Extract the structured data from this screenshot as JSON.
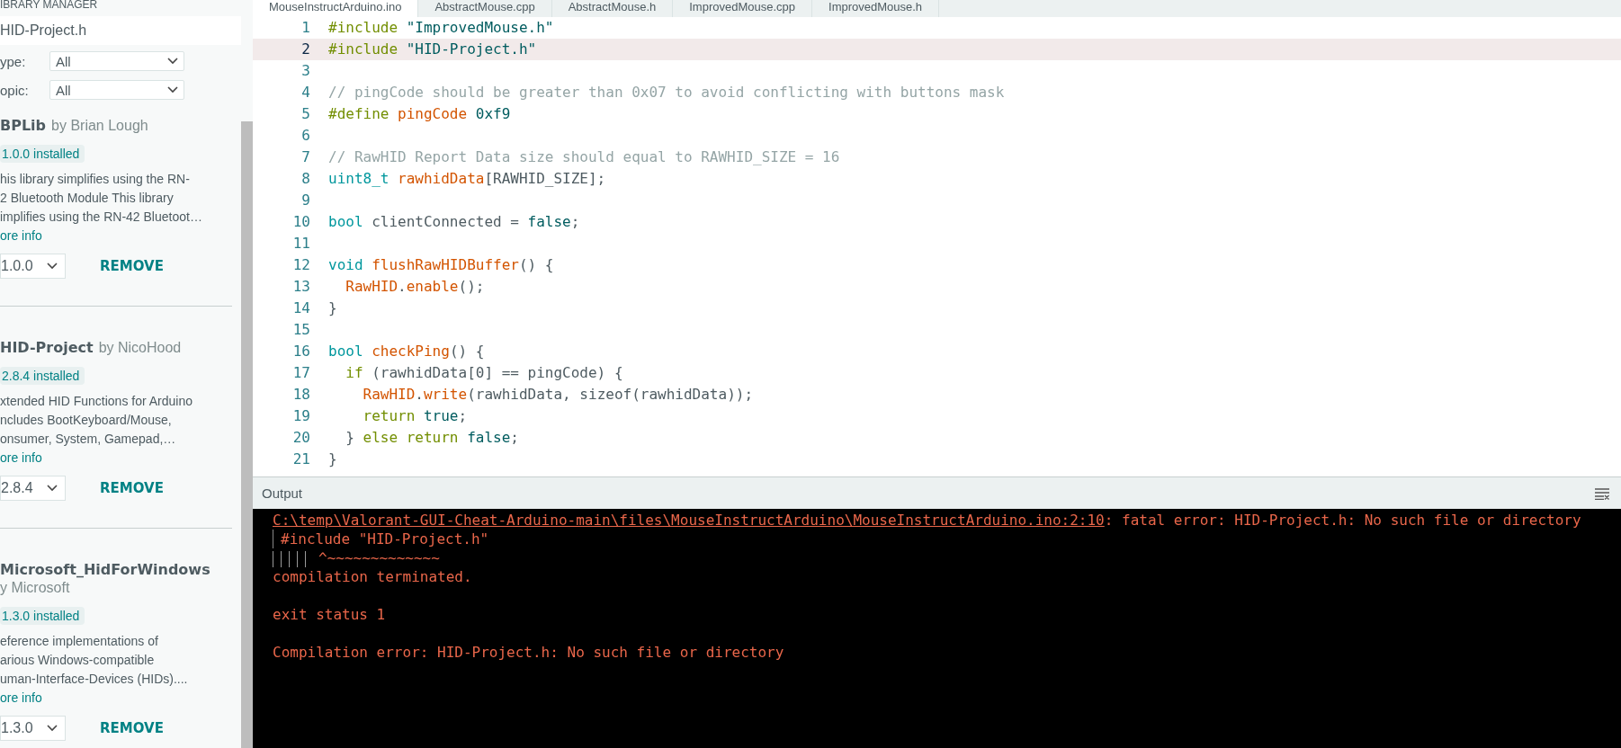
{
  "library_manager": {
    "title": "IBRARY MANAGER",
    "search": {
      "value": "HID-Project.h"
    },
    "filters": [
      {
        "label": "ype:",
        "value": "All"
      },
      {
        "label": "opic:",
        "value": "All"
      }
    ],
    "libraries": [
      {
        "name": "BPLib",
        "author": "by Brian Lough",
        "badge": "1.0.0 installed",
        "description": [
          "his library simplifies using the RN-",
          "2 Bluetooth Module This library",
          "implifies using the RN-42 Bluetoot…"
        ],
        "more_info": "ore info",
        "version": "1.0.0",
        "action": "REMOVE"
      },
      {
        "name": "HID-Project",
        "author": "by NicoHood",
        "badge": "2.8.4 installed",
        "description": [
          "xtended HID Functions for Arduino",
          "ncludes BootKeyboard/Mouse,",
          "onsumer, System, Gamepad,…"
        ],
        "more_info": "ore info",
        "version": "2.8.4",
        "action": "REMOVE"
      },
      {
        "name": "Microsoft_HidForWindows",
        "author": "y Microsoft",
        "badge": "1.3.0 installed",
        "description": [
          "eference implementations of",
          "arious Windows-compatible",
          "uman-Interface-Devices (HIDs)...."
        ],
        "more_info": "ore info",
        "version": "1.3.0",
        "action": "REMOVE"
      }
    ]
  },
  "editor": {
    "tabs": [
      {
        "label": "MouseInstructArduino.ino",
        "selected": true
      },
      {
        "label": "AbstractMouse.cpp",
        "selected": false
      },
      {
        "label": "AbstractMouse.h",
        "selected": false
      },
      {
        "label": "ImprovedMouse.cpp",
        "selected": false
      },
      {
        "label": "ImprovedMouse.h",
        "selected": false
      }
    ],
    "lines": [
      {
        "number": "1",
        "current": false,
        "tokens": [
          {
            "kind": "directive",
            "text": "#include "
          },
          {
            "kind": "string",
            "text": "\"ImprovedMouse.h\""
          }
        ]
      },
      {
        "number": "2",
        "current": true,
        "tokens": [
          {
            "kind": "directive",
            "text": "#include "
          },
          {
            "kind": "string",
            "text": "\"HID-Project.h\""
          }
        ]
      },
      {
        "number": "3",
        "current": false
      },
      {
        "number": "4",
        "current": false,
        "tokens": [
          {
            "kind": "comment",
            "text": "// pingCode should be greater than 0x07 to avoid conflicting with buttons mask"
          }
        ]
      },
      {
        "number": "5",
        "current": false,
        "tokens": [
          {
            "kind": "directive",
            "text": "#define "
          },
          {
            "kind": "func",
            "text": "pingCode "
          },
          {
            "kind": "literal",
            "text": "0xf9"
          }
        ]
      },
      {
        "number": "6",
        "current": false
      },
      {
        "number": "7",
        "current": false,
        "tokens": [
          {
            "kind": "comment",
            "text": "// RawHID Report Data size should equal to RAWHID_SIZE = 16"
          }
        ]
      },
      {
        "number": "8",
        "current": false,
        "tokens": [
          {
            "kind": "type",
            "text": "uint8_t "
          },
          {
            "kind": "func",
            "text": "rawhidData"
          },
          {
            "kind": "plain",
            "text": "[RAWHID_SIZE];"
          }
        ]
      },
      {
        "number": "9",
        "current": false
      },
      {
        "number": "10",
        "current": false,
        "tokens": [
          {
            "kind": "type",
            "text": "bool"
          },
          {
            "kind": "plain",
            "text": " clientConnected = "
          },
          {
            "kind": "literal",
            "text": "false"
          },
          {
            "kind": "plain",
            "text": ";"
          }
        ]
      },
      {
        "number": "11",
        "current": false
      },
      {
        "number": "12",
        "current": false,
        "tokens": [
          {
            "kind": "type",
            "text": "void "
          },
          {
            "kind": "func",
            "text": "flushRawHIDBuffer"
          },
          {
            "kind": "plain",
            "text": "() {"
          }
        ]
      },
      {
        "number": "13",
        "current": false,
        "tokens": [
          {
            "kind": "func",
            "text": "  RawHID"
          },
          {
            "kind": "plain",
            "text": "."
          },
          {
            "kind": "func",
            "text": "enable"
          },
          {
            "kind": "plain",
            "text": "();"
          }
        ]
      },
      {
        "number": "14",
        "current": false,
        "tokens": [
          {
            "kind": "plain",
            "text": "}"
          }
        ]
      },
      {
        "number": "15",
        "current": false
      },
      {
        "number": "16",
        "current": false,
        "tokens": [
          {
            "kind": "type",
            "text": "bool "
          },
          {
            "kind": "func",
            "text": "checkPing"
          },
          {
            "kind": "plain",
            "text": "() {"
          }
        ]
      },
      {
        "number": "17",
        "current": false,
        "tokens": [
          {
            "kind": "keyword",
            "text": "  if"
          },
          {
            "kind": "plain",
            "text": " (rawhidData[0] == pingCode) {"
          }
        ]
      },
      {
        "number": "18",
        "current": false,
        "tokens": [
          {
            "kind": "func",
            "text": "    RawHID"
          },
          {
            "kind": "plain",
            "text": "."
          },
          {
            "kind": "func",
            "text": "write"
          },
          {
            "kind": "plain",
            "text": "(rawhidData, sizeof(rawhidData));"
          }
        ]
      },
      {
        "number": "19",
        "current": false,
        "tokens": [
          {
            "kind": "keyword",
            "text": "    return "
          },
          {
            "kind": "literal",
            "text": "true"
          },
          {
            "kind": "plain",
            "text": ";"
          }
        ]
      },
      {
        "number": "20",
        "current": false,
        "tokens": [
          {
            "kind": "plain",
            "text": "  } "
          },
          {
            "kind": "keyword",
            "text": "else return "
          },
          {
            "kind": "literal",
            "text": "false"
          },
          {
            "kind": "plain",
            "text": ";"
          }
        ]
      },
      {
        "number": "21",
        "current": false,
        "tokens": [
          {
            "kind": "plain",
            "text": "}"
          }
        ]
      }
    ]
  },
  "output": {
    "title": "Output",
    "lines": [
      {
        "kind": "error",
        "link": "C:\\temp\\Valorant-GUI-Cheat-Arduino-main\\files\\MouseInstructArduino\\MouseInstructArduino.ino:2:10",
        "text": ": fatal error: HID-Project.h: No such file or directory"
      },
      {
        "kind": "source",
        "text": "#include \"HID-Project.h\""
      },
      {
        "kind": "caret",
        "text": "^~~~~~~~~~~~~~"
      },
      {
        "kind": "text",
        "text": "compilation terminated."
      },
      {
        "kind": "spacer"
      },
      {
        "kind": "text",
        "text": "exit status 1"
      },
      {
        "kind": "spacer"
      },
      {
        "kind": "text",
        "text": "Compilation error: HID-Project.h: No such file or directory"
      }
    ]
  }
}
